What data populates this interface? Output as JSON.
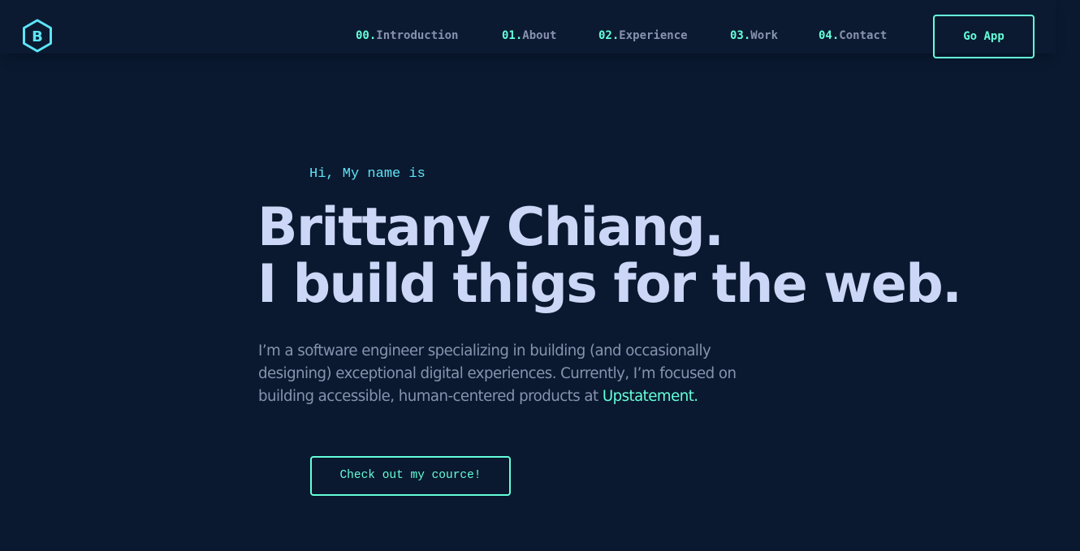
{
  "header": {
    "logo": {
      "letter": "B",
      "icon": "hexagon-logo-icon",
      "color": "#5de4f8"
    },
    "nav": [
      {
        "num": "00.",
        "label": "Introduction"
      },
      {
        "num": "01.",
        "label": "About"
      },
      {
        "num": "02.",
        "label": "Experience"
      },
      {
        "num": "03.",
        "label": "Work"
      },
      {
        "num": "04.",
        "label": "Contact"
      }
    ],
    "cta_label": "Go App"
  },
  "hero": {
    "greeting": "Hi, My name is",
    "name": "Brittany Chiang.",
    "tagline": "I build thigs for the web.",
    "intro_text": "I’m a software engineer specializing in building (and occasionally designing) exceptional digital experiences. Currently, I’m focused on building accessible, human-centered products at ",
    "intro_link": "Upstatement",
    "intro_end": ".",
    "button_label": "Check out my cource!"
  },
  "colors": {
    "background": "#0a192f",
    "accent": "#64ffda",
    "heading": "#ccd6f6",
    "body_text": "#8892b0",
    "greeting": "#5de4f8"
  }
}
